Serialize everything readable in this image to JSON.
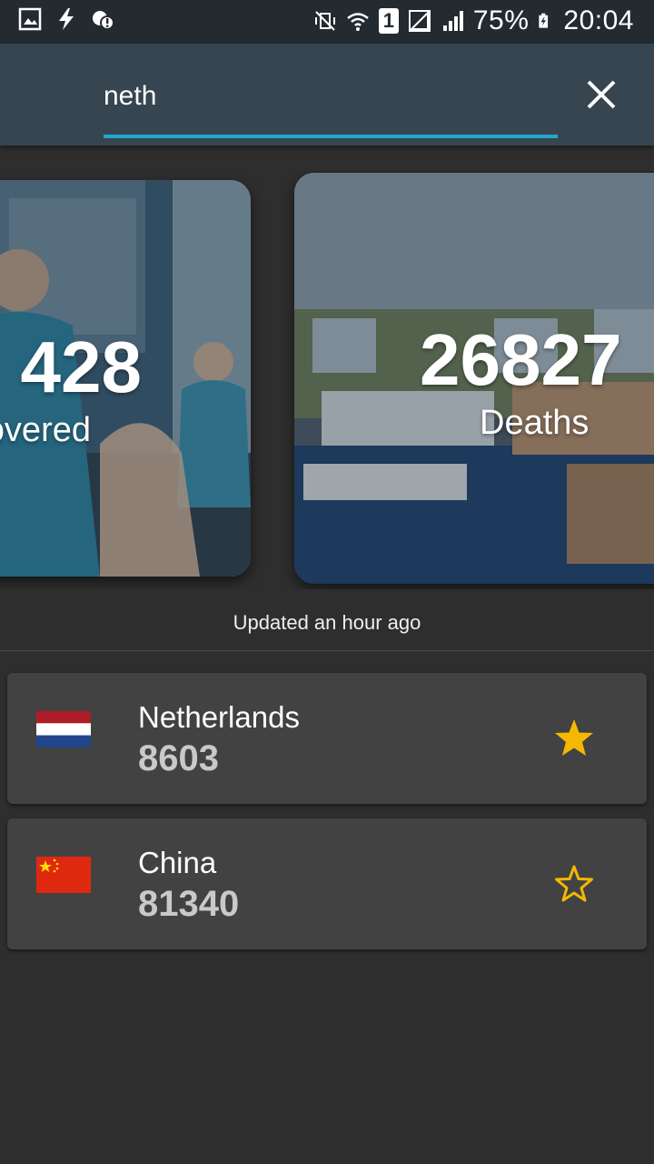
{
  "status_bar": {
    "battery_percent": "75%",
    "time": "20:04",
    "sim_slot": "1"
  },
  "search": {
    "query": "neth",
    "close_icon": "close-icon"
  },
  "cards": [
    {
      "number": "428",
      "label": "overed"
    },
    {
      "number": "26827",
      "label": "Deaths"
    }
  ],
  "updated_text": "Updated an hour ago",
  "countries": [
    {
      "name": "Netherlands",
      "count": "8603",
      "favorite": true
    },
    {
      "name": "China",
      "count": "81340",
      "favorite": false
    }
  ],
  "colors": {
    "accent": "#22a7c9",
    "star": "#f5b800",
    "header": "#36454f",
    "background": "#2e2e2e",
    "row": "#424242"
  }
}
